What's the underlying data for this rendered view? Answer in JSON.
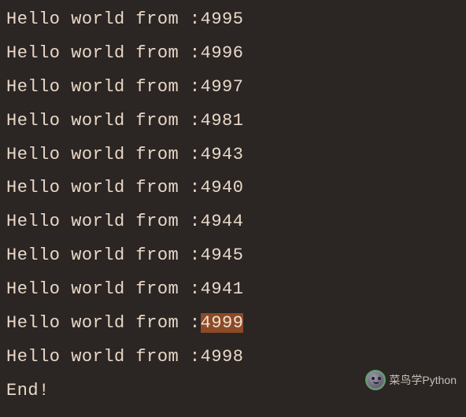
{
  "prefix": "Hello world from :",
  "lines": [
    {
      "value": "4995",
      "highlight": false
    },
    {
      "value": "4996",
      "highlight": false
    },
    {
      "value": "4997",
      "highlight": false
    },
    {
      "value": "4981",
      "highlight": false
    },
    {
      "value": "4943",
      "highlight": false
    },
    {
      "value": "4940",
      "highlight": false
    },
    {
      "value": "4944",
      "highlight": false
    },
    {
      "value": "4945",
      "highlight": false
    },
    {
      "value": "4941",
      "highlight": false
    },
    {
      "value": "4999",
      "highlight": true
    },
    {
      "value": "4998",
      "highlight": false
    }
  ],
  "end_text": "End!",
  "watermark": {
    "text": "菜鸟学Python",
    "icon_name": "wechat-avatar-icon"
  }
}
